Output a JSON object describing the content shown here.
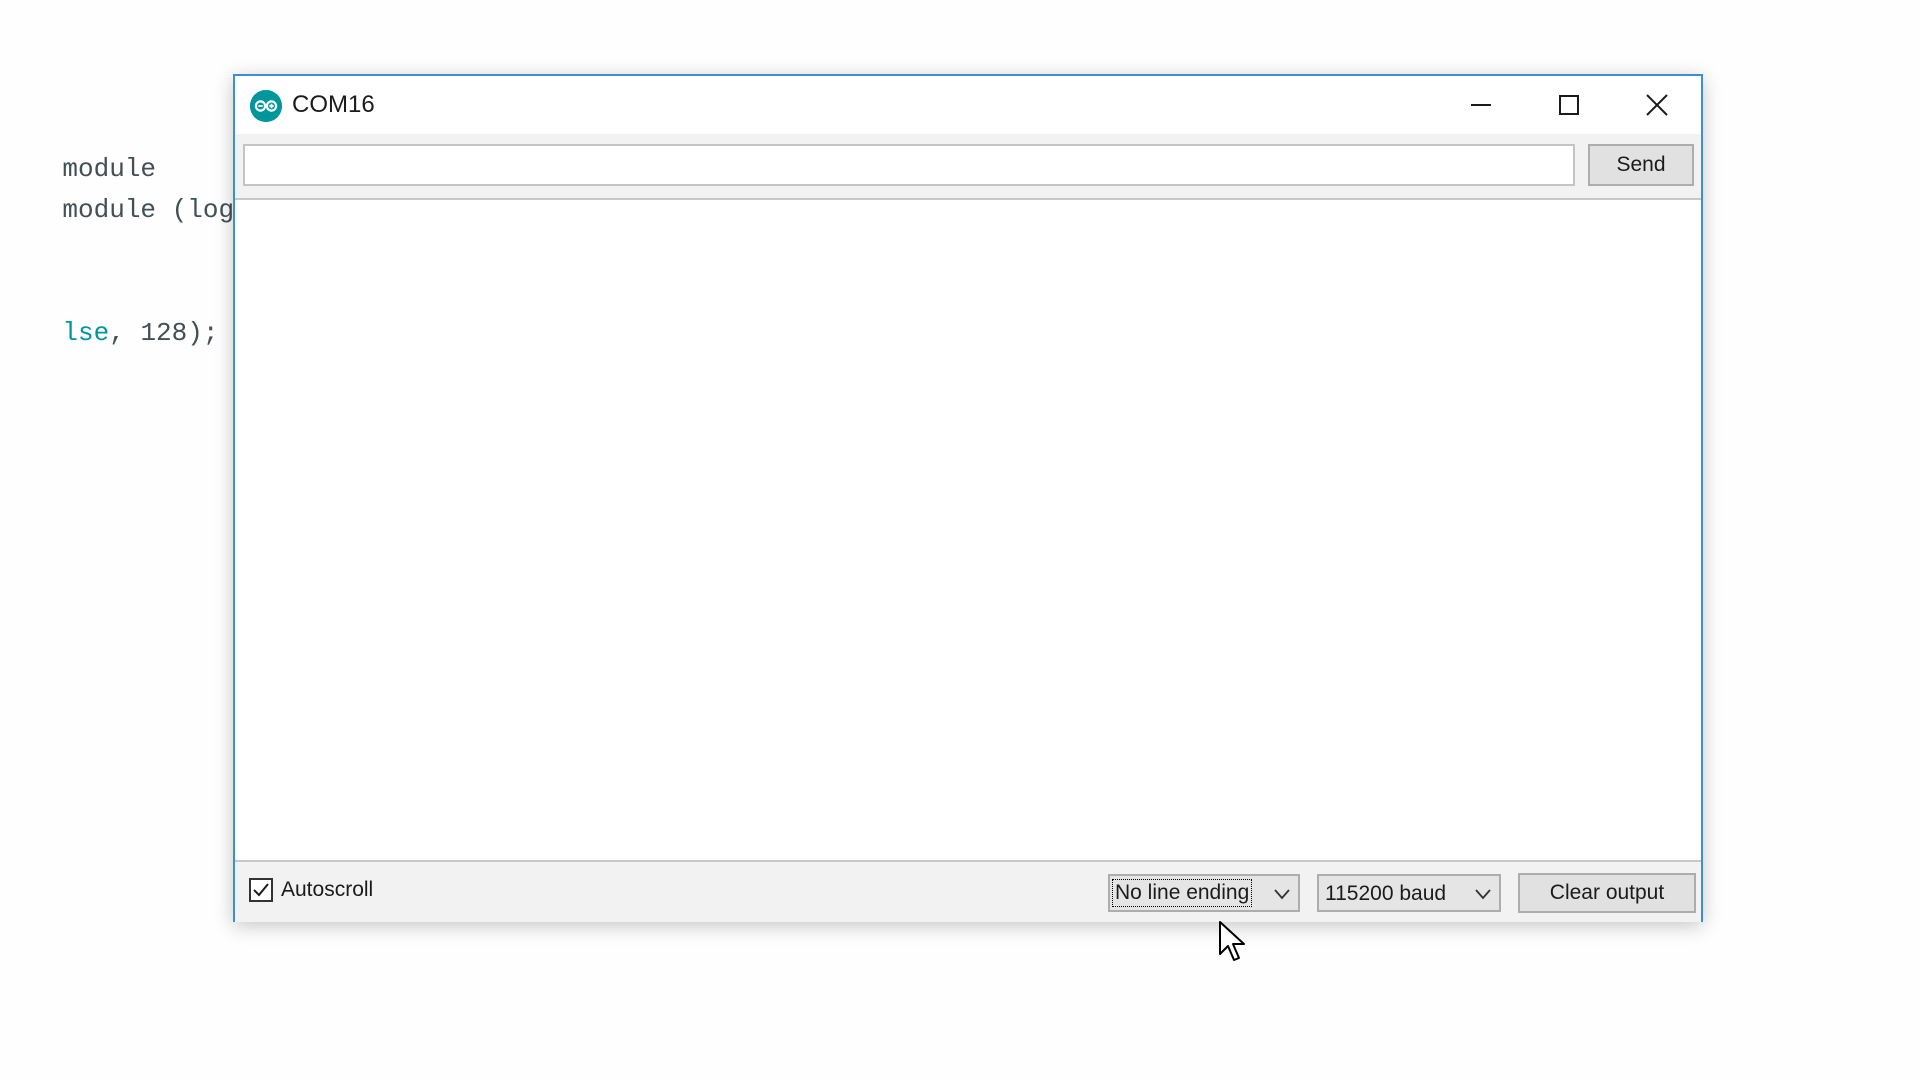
{
  "background_code": {
    "lines": [
      {
        "plain": "module",
        "kw": ""
      },
      {
        "plain": "module (logic",
        "kw": ""
      },
      {
        "kw": "lse",
        "plain": ", 128);"
      }
    ]
  },
  "window": {
    "title": "COM16",
    "icon": "arduino-logo-icon",
    "controls": [
      "minimize-icon",
      "maximize-icon",
      "close-icon"
    ]
  },
  "input": {
    "value": "",
    "send_label": "Send"
  },
  "output": {
    "text": ""
  },
  "bottom_bar": {
    "autoscroll_label": "Autoscroll",
    "autoscroll_checked": true,
    "line_ending_selected": "No line ending",
    "baud_selected": "115200 baud",
    "clear_label": "Clear output"
  },
  "colors": {
    "window_border": "#3c8fd3",
    "arduino_teal": "#00979c",
    "panel_bg": "#f2f2f2"
  }
}
